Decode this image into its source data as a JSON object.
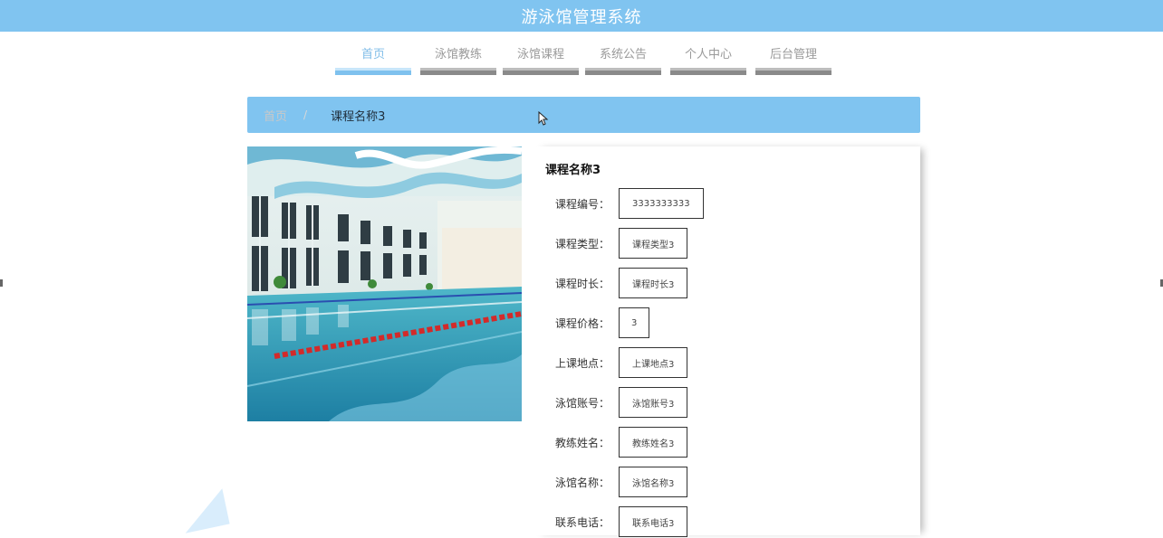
{
  "header": {
    "title": "游泳馆管理系统"
  },
  "nav": [
    {
      "label": "首页",
      "active": true
    },
    {
      "label": "泳馆教练",
      "active": false
    },
    {
      "label": "泳馆课程",
      "active": false
    },
    {
      "label": "系统公告",
      "active": false
    },
    {
      "label": "个人中心",
      "active": false
    },
    {
      "label": "后台管理",
      "active": false
    }
  ],
  "breadcrumb": {
    "home": "首页",
    "separator": "/",
    "current": "课程名称3"
  },
  "image": {
    "subject": "indoor swimming pool with lane ropes"
  },
  "detail": {
    "title": "课程名称3",
    "fields": [
      {
        "label": "课程编号：",
        "value": "3333333333"
      },
      {
        "label": "课程类型：",
        "value": "课程类型3"
      },
      {
        "label": "课程时长：",
        "value": "课程时长3"
      },
      {
        "label": "课程价格：",
        "value": "3"
      },
      {
        "label": "上课地点：",
        "value": "上课地点3"
      },
      {
        "label": "泳馆账号：",
        "value": "泳馆账号3"
      },
      {
        "label": "教练姓名：",
        "value": "教练姓名3"
      },
      {
        "label": "泳馆名称：",
        "value": "泳馆名称3"
      },
      {
        "label": "联系电话：",
        "value": "联系电话3"
      }
    ]
  },
  "colors": {
    "primary": "#80c4f0",
    "nav_active": "#80bde8",
    "nav_inactive": "#9a9a9a"
  }
}
